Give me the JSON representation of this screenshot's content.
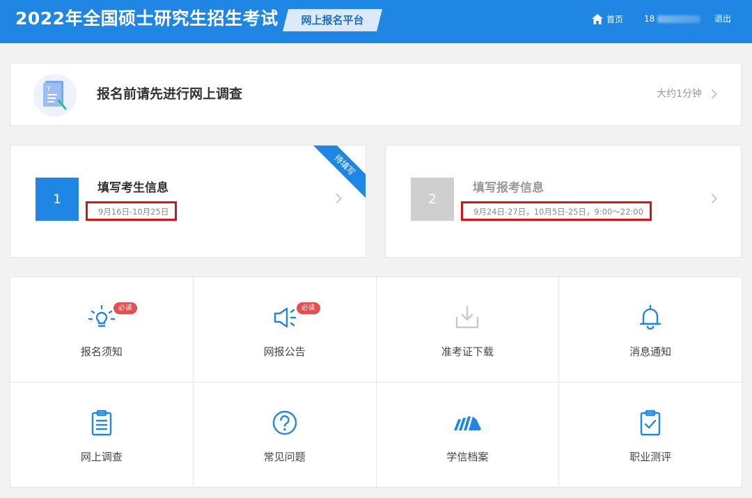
{
  "header": {
    "site_title": "2022年全国硕士研究生招生考试",
    "platform_tag": "网上报名平台",
    "home_label": "首页",
    "user_id_visible": "18",
    "logout_label": "退出"
  },
  "survey": {
    "title": "报名前请先进行网上调查",
    "time_hint": "大约1分钟"
  },
  "steps": [
    {
      "number": "1",
      "title": "填写考生信息",
      "dates": "9月16日-10月25日",
      "ribbon": "待填写"
    },
    {
      "number": "2",
      "title": "填写报考信息",
      "dates": "9月24日-27日，10月5日-25日，9:00～22:00"
    }
  ],
  "grid": [
    {
      "label": "报名须知",
      "badge": "必读",
      "icon": "lightbulb-icon"
    },
    {
      "label": "网报公告",
      "badge": "必读",
      "icon": "megaphone-icon"
    },
    {
      "label": "准考证下载",
      "icon": "download-icon"
    },
    {
      "label": "消息通知",
      "icon": "bell-icon"
    },
    {
      "label": "网上调查",
      "icon": "clipboard-icon"
    },
    {
      "label": "常见问题",
      "icon": "question-icon"
    },
    {
      "label": "学信档案",
      "icon": "chsi-logo-icon"
    },
    {
      "label": "职业测评",
      "icon": "clipboard-check-icon"
    }
  ],
  "colors": {
    "primary": "#1f86e3",
    "badge_red": "#e64d4f",
    "highlight_red": "#d5111a",
    "disabled_gray": "#cfcfcf"
  }
}
